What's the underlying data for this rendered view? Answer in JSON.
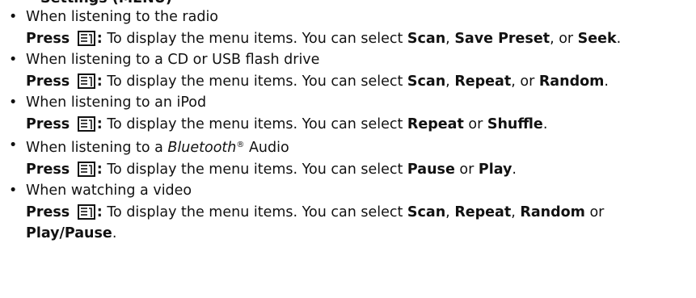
{
  "clipped_heading": "Settings (MENU)",
  "bullet": "•",
  "press_label": "Press",
  "colon": ":",
  "desc_prefix": " To display the menu items. You can select ",
  "comma": ", ",
  "comma_or": ", or ",
  "or": " or ",
  "period": ".",
  "icon": "menu-icon",
  "items": [
    {
      "condition": "When listening to the radio",
      "options": [
        "Scan",
        "Save Preset",
        "Seek"
      ]
    },
    {
      "condition": "When listening to a CD or USB flash drive",
      "options": [
        "Scan",
        "Repeat",
        "Random"
      ]
    },
    {
      "condition": "When listening to an iPod",
      "options": [
        "Repeat",
        "Shuffle"
      ]
    },
    {
      "condition_pre": "When listening to a ",
      "condition_brand": "Bluetooth",
      "condition_mark": "®",
      "condition_post": " Audio",
      "options": [
        "Pause",
        "Play"
      ]
    },
    {
      "condition": "When watching a video",
      "options": [
        "Scan",
        "Repeat",
        "Random",
        "Play/Pause"
      ]
    }
  ]
}
